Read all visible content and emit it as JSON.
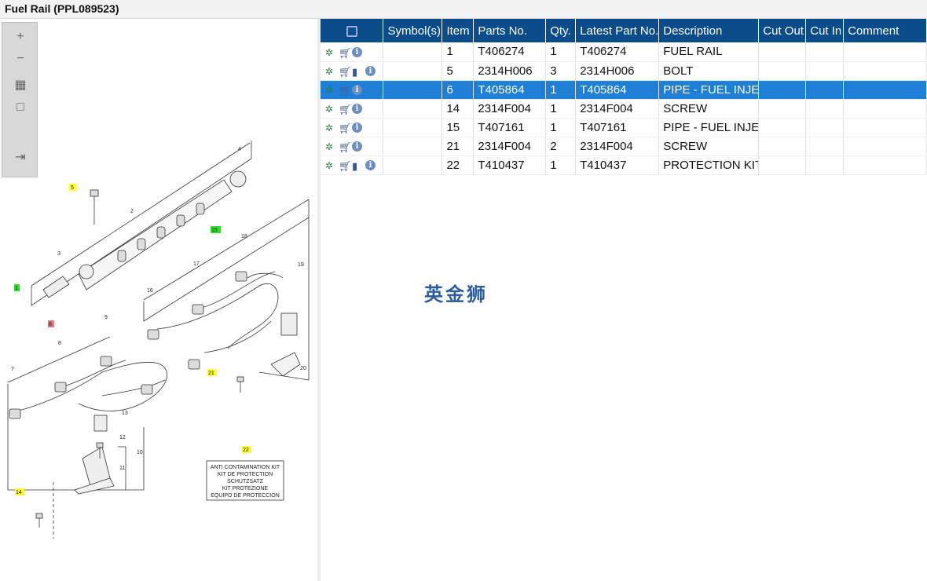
{
  "window": {
    "title": "Fuel Rail (PPL089523)"
  },
  "toolbar": {
    "buttons": [
      {
        "name": "zoom-in",
        "glyph": "+"
      },
      {
        "name": "zoom-out",
        "glyph": "−"
      },
      {
        "name": "fit-all",
        "glyph": "▦"
      },
      {
        "name": "fit-window",
        "glyph": "□"
      },
      {
        "name": "export",
        "glyph": "⇥"
      }
    ]
  },
  "diagram": {
    "callouts": {
      "c1": "1",
      "c2": "2",
      "c3": "3",
      "c4": "4",
      "c5": "5",
      "c6": "6",
      "c7": "7",
      "c8": "8",
      "c9": "9",
      "c10": "10",
      "c11": "11",
      "c12": "12",
      "c13": "13",
      "c14": "14",
      "c15": "15",
      "c16": "16",
      "c17": "17",
      "c18": "18",
      "c19": "19",
      "c20": "20",
      "c21": "21",
      "c22": "22"
    },
    "kit_label": {
      "line1": "ANTI CONTAMINATION KIT",
      "line2": "KIT DE PROTECTION",
      "line3": "SCHUTZSATZ",
      "line4": "KIT PROTEZIONE",
      "line5": "EQUIPO DE PROTECCION"
    }
  },
  "grid": {
    "headers": {
      "symbols": "Symbol(s)",
      "item": "Item",
      "parts_no": "Parts No.",
      "qty": "Qty.",
      "latest": "Latest Part No.",
      "description": "Description",
      "cut_out": "Cut Out",
      "cut_in": "Cut In",
      "comment": "Comment"
    },
    "rows": [
      {
        "item": "1",
        "parts_no": "T406274",
        "qty": "1",
        "latest": "T406274",
        "description": "FUEL RAIL",
        "icons": "gears-cart-info"
      },
      {
        "item": "5",
        "parts_no": "2314H006",
        "qty": "3",
        "latest": "2314H006",
        "description": "BOLT",
        "icons": "gear-cart-book-info"
      },
      {
        "item": "6",
        "parts_no": "T405864",
        "qty": "1",
        "latest": "T405864",
        "description": "PIPE - FUEL INJECT",
        "icons": "gears-cart-info"
      },
      {
        "item": "14",
        "parts_no": "2314F004",
        "qty": "1",
        "latest": "2314F004",
        "description": "SCREW",
        "icons": "gear-cart-info"
      },
      {
        "item": "15",
        "parts_no": "T407161",
        "qty": "1",
        "latest": "T407161",
        "description": "PIPE - FUEL INJECT",
        "icons": "gears-cart-info"
      },
      {
        "item": "21",
        "parts_no": "2314F004",
        "qty": "2",
        "latest": "2314F004",
        "description": "SCREW",
        "icons": "gear-cart-info"
      },
      {
        "item": "22",
        "parts_no": "T410437",
        "qty": "1",
        "latest": "T410437",
        "description": "PROTECTION KIT",
        "icons": "gear-cart-book-info"
      }
    ],
    "selected_item": "6"
  },
  "watermark": "英金狮",
  "colors": {
    "header_bg": "#0b4c8a",
    "selected_row": "#1e7fd6",
    "callout_yellow": "#ffff33",
    "callout_green": "#33dd33",
    "callout_red": "#e07a7a"
  }
}
